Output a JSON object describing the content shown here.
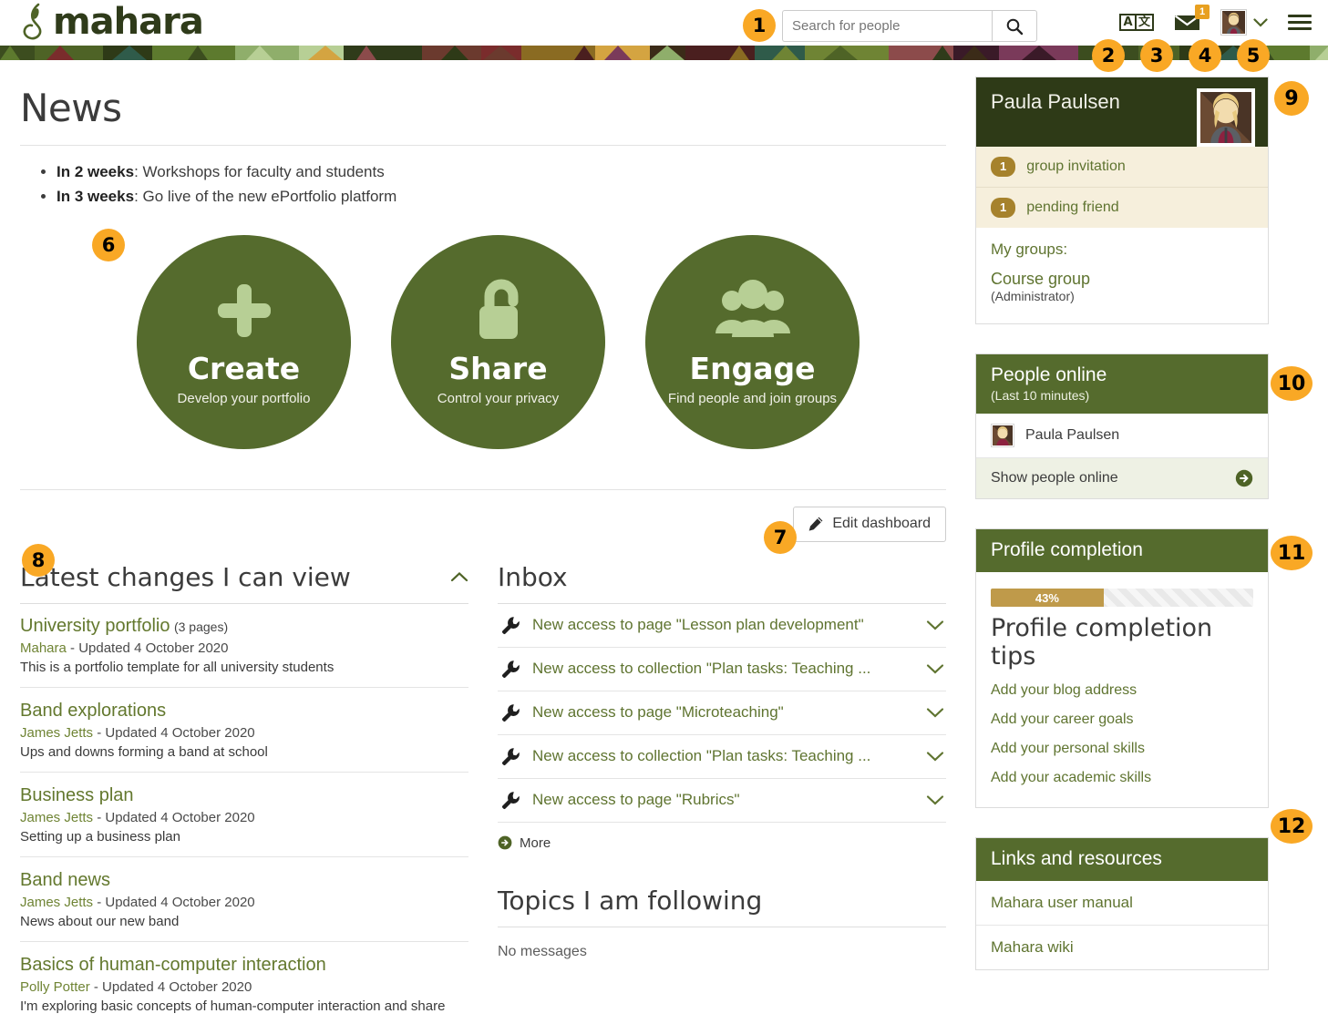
{
  "header": {
    "logo_text": "mahara",
    "search": {
      "placeholder": "Search for people",
      "value": "",
      "icon": "search-icon",
      "button_label": ""
    },
    "nav": {
      "language_icon": {
        "name": "language-toggle-icon",
        "left": "A",
        "right": "文"
      },
      "mail_icon": {
        "name": "envelope-icon",
        "badge": "1"
      },
      "avatar_icon": {
        "name": "user-avatar-icon"
      },
      "chevron_icon": {
        "name": "chevron-down-icon"
      },
      "menu_icon": {
        "name": "hamburger-menu-icon"
      }
    }
  },
  "callouts": [
    {
      "n": "1"
    },
    {
      "n": "2"
    },
    {
      "n": "3"
    },
    {
      "n": "4"
    },
    {
      "n": "5"
    },
    {
      "n": "6"
    },
    {
      "n": "7"
    },
    {
      "n": "8"
    },
    {
      "n": "9"
    },
    {
      "n": "10"
    },
    {
      "n": "11"
    },
    {
      "n": "12"
    }
  ],
  "news": {
    "title": "News",
    "items": [
      {
        "lead": "In 2 weeks",
        "rest": ": Workshops for faculty and students"
      },
      {
        "lead": "In 3 weeks",
        "rest": ": Go live of the new ePortfolio platform"
      }
    ]
  },
  "circles": [
    {
      "title": "Create",
      "subtitle": "Develop your portfolio",
      "icon": "plus-icon"
    },
    {
      "title": "Share",
      "subtitle": "Control your privacy",
      "icon": "unlock-icon"
    },
    {
      "title": "Engage",
      "subtitle": "Find people and join groups",
      "icon": "people-group-icon"
    }
  ],
  "toolbar": {
    "edit_dashboard_label": "Edit dashboard",
    "edit_icon": "pencil-icon"
  },
  "latest_changes": {
    "title": "Latest changes I can view",
    "collapse_icon": "chevron-up-icon",
    "items": [
      {
        "title": "University portfolio",
        "pages": "(3 pages)",
        "author": "Mahara",
        "meta_rest": " - Updated 4 October 2020",
        "desc": "This is a portfolio template for all university students"
      },
      {
        "title": "Band explorations",
        "pages": "",
        "author": "James Jetts",
        "meta_rest": " - Updated 4 October 2020",
        "desc": "Ups and downs forming a band at school"
      },
      {
        "title": "Business plan",
        "pages": "",
        "author": "James Jetts",
        "meta_rest": " - Updated 4 October 2020",
        "desc": "Setting up a business plan"
      },
      {
        "title": "Band news",
        "pages": "",
        "author": "James Jetts",
        "meta_rest": " - Updated 4 October 2020",
        "desc": "News about our new band"
      },
      {
        "title": "Basics of human-computer interaction",
        "pages": "",
        "author": "Polly Potter",
        "meta_rest": " - Updated 4 October 2020",
        "desc": "I'm exploring basic concepts of human-computer interaction and share"
      }
    ]
  },
  "inbox": {
    "title": "Inbox",
    "more_label": "More",
    "items": [
      {
        "label": "New access to page \"Lesson plan development\"",
        "icon": "wrench-icon",
        "toggle": "chevron-down-icon"
      },
      {
        "label": "New access to collection \"Plan tasks: Teaching ...",
        "icon": "wrench-icon",
        "toggle": "chevron-down-icon"
      },
      {
        "label": "New access to page \"Microteaching\"",
        "icon": "wrench-icon",
        "toggle": "chevron-down-icon"
      },
      {
        "label": "New access to collection \"Plan tasks: Teaching ...",
        "icon": "wrench-icon",
        "toggle": "chevron-down-icon"
      },
      {
        "label": "New access to page \"Rubrics\"",
        "icon": "wrench-icon",
        "toggle": "chevron-down-icon"
      }
    ]
  },
  "topics": {
    "title": "Topics I am following",
    "empty": "No messages"
  },
  "sidebar": {
    "profile": {
      "name": "Paula Paulsen",
      "notices": [
        {
          "count": "1",
          "label": "group invitation"
        },
        {
          "count": "1",
          "label": "pending friend"
        }
      ],
      "groups_label": "My groups:",
      "group_name": "Course group",
      "group_role": "(Administrator)"
    },
    "people_online": {
      "title": "People online",
      "subtitle": "(Last 10 minutes)",
      "people": [
        {
          "name": "Paula Paulsen"
        }
      ],
      "footer_label": "Show people online",
      "footer_icon": "arrow-right-circle-icon"
    },
    "profile_completion": {
      "title": "Profile completion",
      "percent_label": "43%",
      "percent": 43,
      "tips_title": "Profile completion tips",
      "tips": [
        "Add your blog address",
        "Add your career goals",
        "Add your personal skills",
        "Add your academic skills"
      ]
    },
    "links": {
      "title": "Links and resources",
      "items": [
        "Mahara user manual",
        "Mahara wiki"
      ]
    }
  },
  "colors": {
    "brand_dark": "#2e3a17",
    "brand_green": "#556b2d",
    "link_green": "#5f7430",
    "callout_orange": "#f9a825",
    "badge_gold": "#a6822c",
    "progress_fill": "#bf9a4a",
    "notice_bg": "#f6efdc"
  }
}
